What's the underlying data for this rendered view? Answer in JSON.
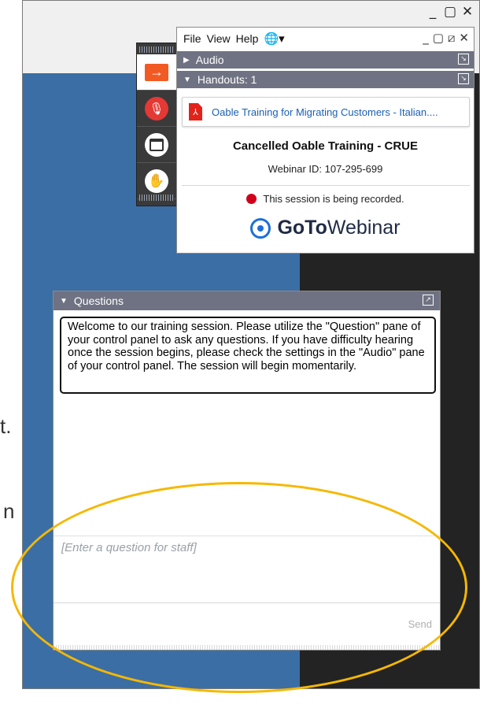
{
  "outer_window": {
    "controls": [
      "_",
      "▢",
      "✕"
    ]
  },
  "background_text": {
    "line1": "t.",
    "line2": "n"
  },
  "grabtab": {
    "buttons": [
      {
        "name": "collapse-panel",
        "icon": "arrow-right-icon"
      },
      {
        "name": "microphone",
        "icon": "mic-muted-icon"
      },
      {
        "name": "screen",
        "icon": "screen-icon"
      },
      {
        "name": "raise-hand",
        "icon": "hand-icon"
      }
    ],
    "arrow_glyph": "→",
    "mic_glyph": "🎙",
    "hand_glyph": "✋"
  },
  "menubar": {
    "items": [
      "File",
      "View",
      "Help"
    ],
    "globe": "🌐▾",
    "controls": [
      "_",
      "▢",
      "⧄",
      "✕"
    ]
  },
  "sections": {
    "audio": "Audio",
    "handouts": "Handouts: 1",
    "popout_glyph": "↘"
  },
  "handout": {
    "pdf_label": "⅄",
    "title": "Oable Training for Migrating Customers - Italian...."
  },
  "session": {
    "title": "Cancelled Oable Training - CRUE",
    "webinar_id": "Webinar ID: 107-295-699",
    "recording": "This session is being recorded."
  },
  "logo": {
    "bold": "GoTo",
    "light": "Webinar"
  },
  "questions": {
    "header": "Questions",
    "popout_glyph": "↗",
    "welcome": "Welcome to our training session. Please utilize the \"Question\" pane of your control panel to ask any questions. If you have difficulty hearing once the session begins, please check the settings in the \"Audio\" pane of your control panel. The session will begin momentarily.",
    "placeholder": "[Enter a question for staff]",
    "send": "Send"
  },
  "colors": {
    "accent_orange": "#f15a22",
    "section_bar": "#6f7282",
    "highlight": "#f5b800",
    "record_red": "#d0021b",
    "link_blue": "#1a5fb4"
  }
}
